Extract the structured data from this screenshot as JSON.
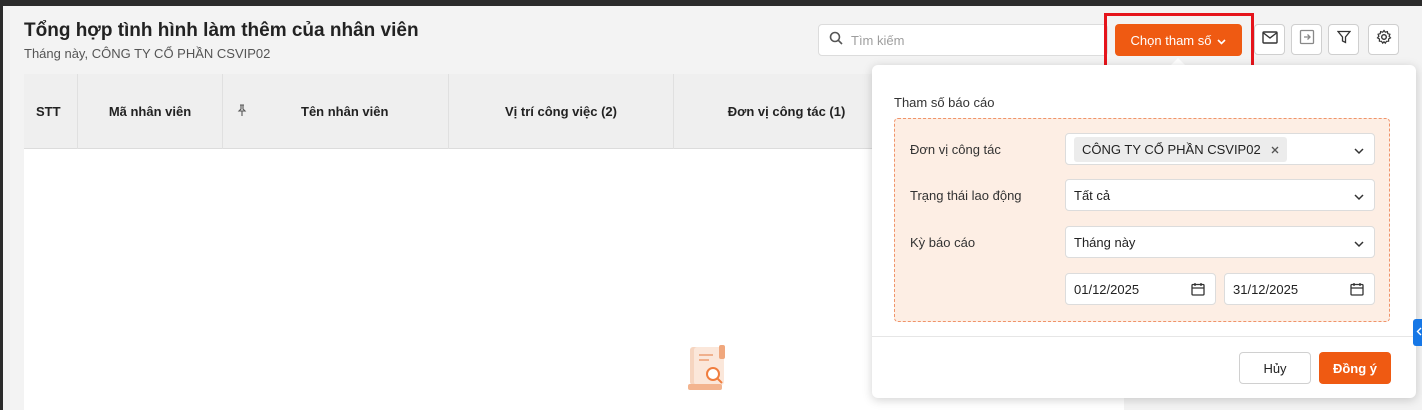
{
  "header": {
    "title": "Tổng hợp tình hình làm thêm của nhân viên",
    "subtitle": "Tháng này, CÔNG TY CỔ PHẦN CSVIP02"
  },
  "search": {
    "placeholder": "Tìm kiếm",
    "value": ""
  },
  "toolbar": {
    "choose_params_label": "Chọn tham số",
    "icons": [
      "mail-icon",
      "export-icon",
      "filter-icon",
      "settings-icon"
    ],
    "accent_color": "#ef5a12",
    "highlight_color": "#e5141b"
  },
  "table": {
    "columns": [
      "STT",
      "Mã nhân viên",
      "Tên nhân viên",
      "Vị trí công việc (2)",
      "Đơn vị công tác (1)"
    ]
  },
  "panel": {
    "title": "Tham số báo cáo",
    "fields": {
      "unit_label": "Đơn vị công tác",
      "unit_value": "CÔNG TY CỔ PHẦN CSVIP02",
      "status_label": "Trạng thái lao động",
      "status_value": "Tất cả",
      "period_label": "Kỳ báo cáo",
      "period_value": "Tháng này",
      "date_from": "01/12/2025",
      "date_to": "31/12/2025"
    },
    "cancel_label": "Hủy",
    "ok_label": "Đồng ý"
  }
}
